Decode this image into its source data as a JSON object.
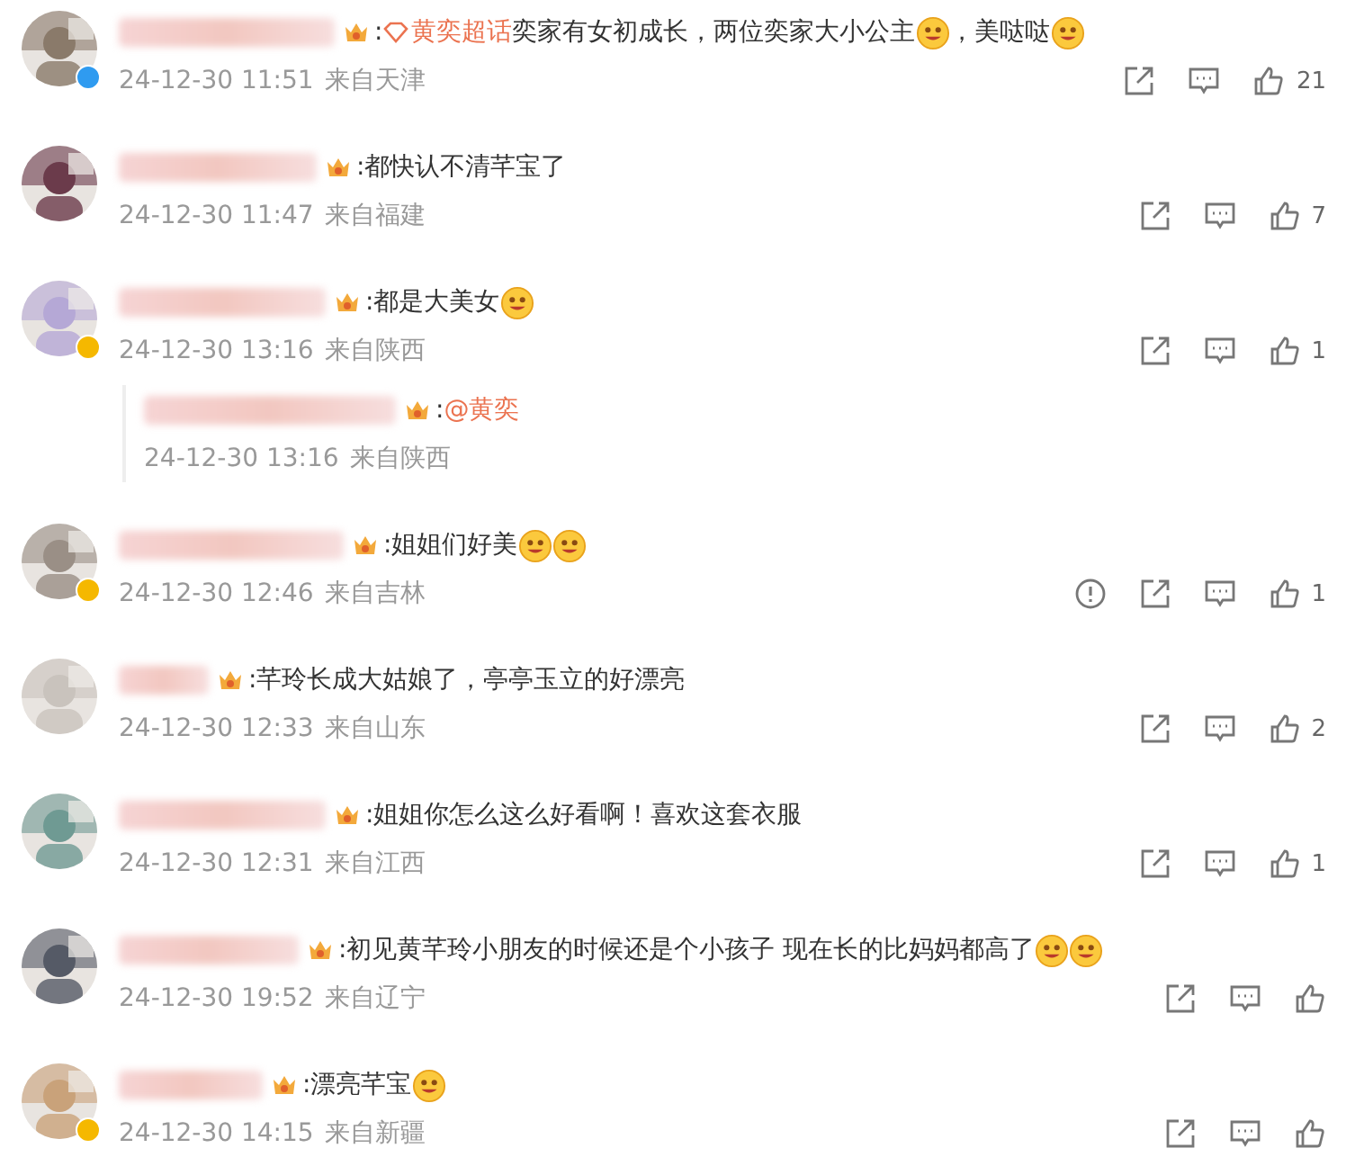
{
  "comments": [
    {
      "avatar": {
        "kind": "picture",
        "badge": {
          "color": "#2f9bf0"
        }
      },
      "segments": [
        {
          "kind": "text",
          "text": ":"
        },
        {
          "kind": "topic",
          "text": "黄奕超话"
        },
        {
          "kind": "text",
          "text": "奕家有女初成长，两位奕家大小公主"
        },
        {
          "kind": "emoji"
        },
        {
          "kind": "text",
          "text": "，美哒哒"
        },
        {
          "kind": "emoji"
        }
      ],
      "date": "24-12-30 11:51",
      "location": "来自天津",
      "report": false,
      "likes": "21"
    },
    {
      "avatar": {
        "kind": "picture"
      },
      "segments": [
        {
          "kind": "text",
          "text": ":都快认不清芊宝了"
        }
      ],
      "date": "24-12-30 11:47",
      "location": "来自福建",
      "report": false,
      "likes": "7"
    },
    {
      "avatar": {
        "kind": "picture",
        "badge": {
          "color": "#f5b800"
        }
      },
      "segments": [
        {
          "kind": "text",
          "text": ":都是大美女"
        },
        {
          "kind": "emoji"
        }
      ],
      "date": "24-12-30 13:16",
      "location": "来自陕西",
      "report": false,
      "likes": "1",
      "replies": [
        {
          "segments": [
            {
              "kind": "text",
              "text": ":"
            },
            {
              "kind": "mention",
              "text": "@黄奕"
            }
          ],
          "date": "24-12-30 13:16",
          "location": "来自陕西"
        }
      ]
    },
    {
      "avatar": {
        "kind": "picture",
        "badge": {
          "color": "#f5b800"
        }
      },
      "segments": [
        {
          "kind": "text",
          "text": ":姐姐们好美"
        },
        {
          "kind": "emoji"
        },
        {
          "kind": "emoji"
        }
      ],
      "date": "24-12-30 12:46",
      "location": "来自吉林",
      "report": true,
      "likes": "1"
    },
    {
      "avatar": {
        "kind": "picture"
      },
      "segments": [
        {
          "kind": "text",
          "text": ":芊玲长成大姑娘了，亭亭玉立的好漂亮"
        }
      ],
      "date": "24-12-30 12:33",
      "location": "来自山东",
      "report": false,
      "likes": "2"
    },
    {
      "avatar": {
        "kind": "picture"
      },
      "segments": [
        {
          "kind": "text",
          "text": ":姐姐你怎么这么好看啊！喜欢这套衣服"
        }
      ],
      "date": "24-12-30 12:31",
      "location": "来自江西",
      "report": false,
      "likes": "1"
    },
    {
      "avatar": {
        "kind": "picture"
      },
      "segments": [
        {
          "kind": "text",
          "text": ":初见黄芊玲小朋友的时候还是个小孩子 现在长的比妈妈都高了"
        },
        {
          "kind": "emoji"
        },
        {
          "kind": "emoji"
        }
      ],
      "date": "24-12-30 19:52",
      "location": "来自辽宁",
      "report": false
    },
    {
      "avatar": {
        "kind": "picture",
        "badge": {
          "color": "#f5b800"
        }
      },
      "segments": [
        {
          "kind": "text",
          "text": ":漂亮芊宝"
        },
        {
          "kind": "emoji"
        }
      ],
      "date": "24-12-30 14:15",
      "location": "来自新疆",
      "report": false
    }
  ]
}
